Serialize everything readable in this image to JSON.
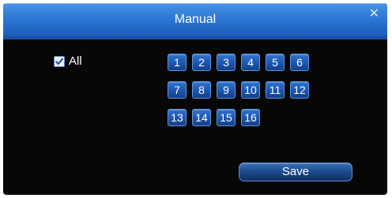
{
  "dialog": {
    "title": "Manual",
    "close_glyph": "✕"
  },
  "select_all": {
    "label": "All",
    "checked": true
  },
  "channels": [
    "1",
    "2",
    "3",
    "4",
    "5",
    "6",
    "7",
    "8",
    "9",
    "10",
    "11",
    "12",
    "13",
    "14",
    "15",
    "16"
  ],
  "buttons": {
    "save_label": "Save"
  },
  "colors": {
    "title_bar": "#2d78d6",
    "background": "#070707",
    "channel_button": "#1d56ad",
    "text": "#ffffff"
  }
}
